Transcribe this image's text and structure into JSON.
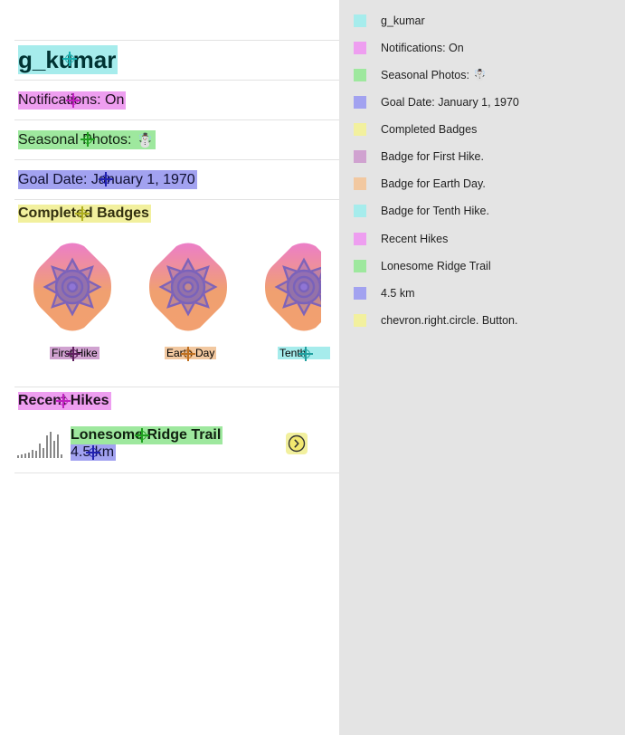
{
  "profile": {
    "username": "g_kumar",
    "notifications": "Notifications: On",
    "seasonal_photos": "Seasonal Photos:",
    "seasonal_emoji": "☃️",
    "goal_date": "Goal Date: January 1, 1970"
  },
  "badges": {
    "title": "Completed Badges",
    "items": [
      {
        "label": "First Hike"
      },
      {
        "label": "Earth Day"
      },
      {
        "label": "Tenth Hike"
      }
    ]
  },
  "recent": {
    "title": "Recent Hikes",
    "hike_name": "Lonesome Ridge Trail",
    "hike_distance": "4.5 km",
    "button_icon": "chevron.right.circle"
  },
  "legend": {
    "items": [
      {
        "label": "g_kumar",
        "color": "#a6ecec"
      },
      {
        "label": "Notifications: On",
        "color": "#ee9ef0"
      },
      {
        "label": "Seasonal Photos: ☃️",
        "color": "#9ee89e"
      },
      {
        "label": "Goal Date: January 1, 1970",
        "color": "#a2a2f0"
      },
      {
        "label": "Completed Badges",
        "color": "#f2f09e"
      },
      {
        "label": "Badge for First Hike.",
        "color": "#d0a2d0"
      },
      {
        "label": "Badge for Earth Day.",
        "color": "#f2c8a0"
      },
      {
        "label": "Badge for Tenth Hike.",
        "color": "#a6ecec"
      },
      {
        "label": "Recent Hikes",
        "color": "#ee9ef0"
      },
      {
        "label": "Lonesome Ridge Trail",
        "color": "#9ee89e"
      },
      {
        "label": "4.5 km",
        "color": "#a2a2f0"
      },
      {
        "label": "chevron.right.circle. Button.",
        "color": "#f2f09e"
      }
    ]
  }
}
